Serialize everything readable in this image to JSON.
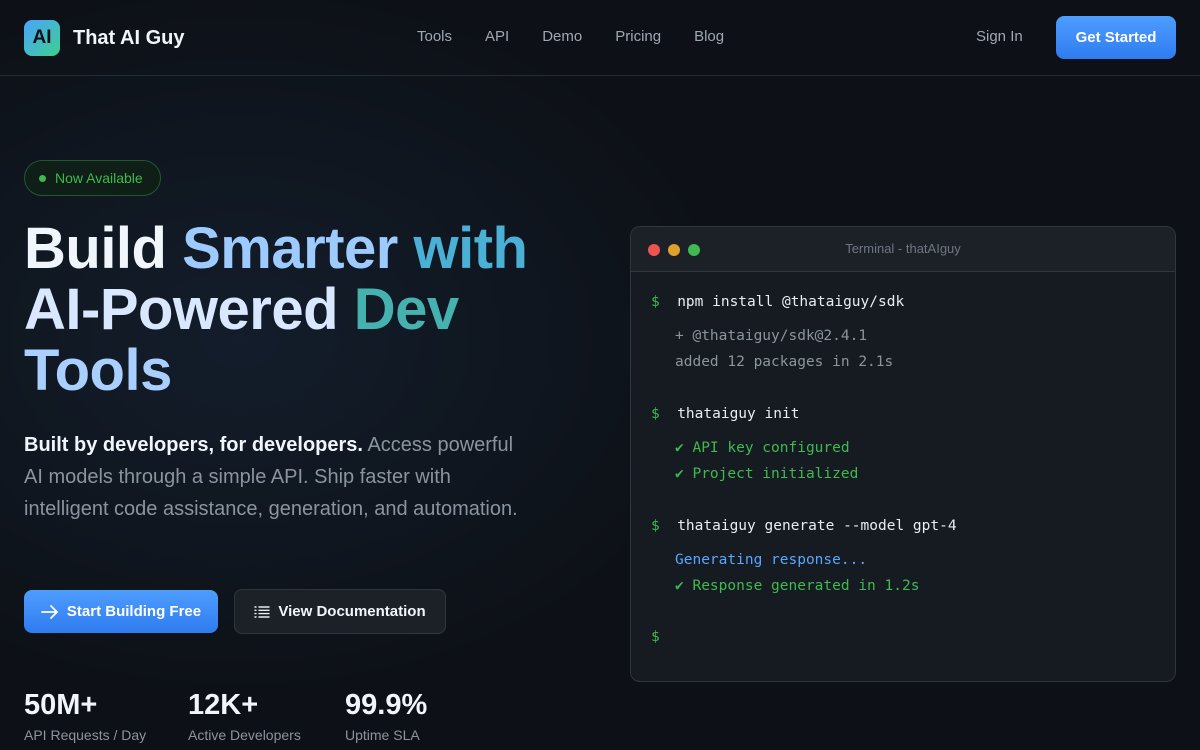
{
  "brand": {
    "logo_text": "AI",
    "name": "That AI Guy"
  },
  "nav": {
    "links": [
      "Tools",
      "API",
      "Demo",
      "Pricing",
      "Blog"
    ],
    "sign_in": "Sign In",
    "get_started": "Get Started"
  },
  "hero": {
    "badge": "Now Available",
    "headline": {
      "line1": [
        "Build",
        "Smarter",
        "with"
      ],
      "line2": [
        "AI-Powered",
        "Dev"
      ],
      "line3": "Tools"
    },
    "desc_strong": "Built by developers, for developers.",
    "desc_rest": " Access powerful AI models through a simple API. Ship faster with intelligent code assistance, generation, and automation.",
    "primary_button": "Start Building Free",
    "secondary_button": "View Documentation"
  },
  "stats": [
    {
      "value": "50M+",
      "label": "API Requests / Day"
    },
    {
      "value": "12K+",
      "label": "Active Developers"
    },
    {
      "value": "99.9%",
      "label": "Uptime SLA"
    }
  ],
  "terminal": {
    "title": "Terminal - thatAIguy",
    "prompt": "$",
    "lines": [
      {
        "kind": "cmd",
        "text": "npm install @thataiguy/sdk"
      },
      {
        "kind": "out",
        "text": "+ @thataiguy/sdk@2.4.1"
      },
      {
        "kind": "out",
        "text": "added 12 packages in 2.1s"
      },
      {
        "kind": "cmd",
        "text": "thataiguy init"
      },
      {
        "kind": "ok",
        "text": "✔ API key configured"
      },
      {
        "kind": "ok",
        "text": "✔ Project initialized"
      },
      {
        "kind": "cmd",
        "text": "thataiguy generate --model gpt-4"
      },
      {
        "kind": "info",
        "text": "Generating response..."
      },
      {
        "kind": "ok",
        "text": "✔ Response generated in 1.2s"
      },
      {
        "kind": "prompt",
        "text": ""
      }
    ]
  },
  "colors": {
    "accent": "#4e9dff",
    "success": "#3fb950",
    "background": "#0d1117"
  }
}
